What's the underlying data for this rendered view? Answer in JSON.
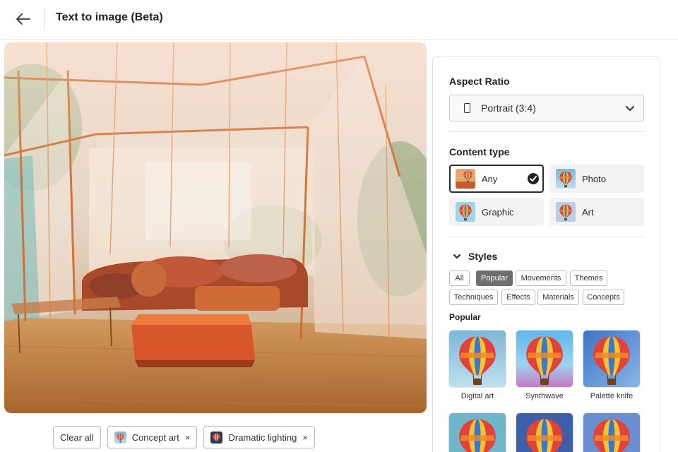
{
  "header": {
    "title": "Text to image (Beta)"
  },
  "chips": [
    {
      "label": "Clear all"
    },
    {
      "label": "Concept art",
      "remove": "×"
    },
    {
      "label": "Dramatic lighting",
      "remove": "×"
    }
  ],
  "panel": {
    "aspect_ratio": {
      "title": "Aspect Ratio",
      "value": "Portrait (3:4)"
    },
    "content_type": {
      "title": "Content type",
      "options": [
        {
          "label": "Any",
          "selected": true
        },
        {
          "label": "Photo"
        },
        {
          "label": "Graphic"
        },
        {
          "label": "Art"
        }
      ]
    },
    "styles": {
      "title": "Styles",
      "filters": [
        "All",
        "Popular",
        "Movements",
        "Themes",
        "Techniques",
        "Effects",
        "Materials",
        "Concepts"
      ],
      "active_filter": "Popular",
      "group_title": "Popular",
      "items": [
        {
          "label": "Digital art"
        },
        {
          "label": "Synthwave"
        },
        {
          "label": "Palette knife"
        }
      ]
    }
  }
}
